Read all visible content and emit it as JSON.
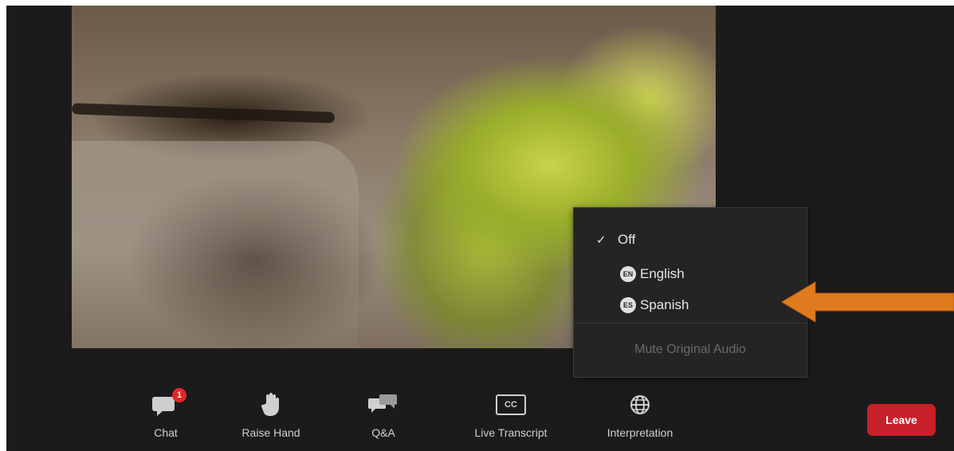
{
  "menu": {
    "items": [
      {
        "label": "Off",
        "checked": true,
        "icon": "checkmark-icon"
      },
      {
        "label": "English",
        "checked": false,
        "icon": "EN",
        "icon_name": "language-badge-icon"
      },
      {
        "label": "Spanish",
        "checked": false,
        "icon": "ES",
        "icon_name": "language-badge-icon"
      }
    ],
    "mute_label": "Mute Original Audio"
  },
  "toolbar": {
    "chat": {
      "label": "Chat",
      "badge": "1",
      "icon": "chat-icon"
    },
    "raise_hand": {
      "label": "Raise Hand",
      "icon": "hand-icon"
    },
    "qa": {
      "label": "Q&A",
      "icon": "qa-icon"
    },
    "live_transcript": {
      "label": "Live Transcript",
      "icon": "cc-icon",
      "icon_text": "CC"
    },
    "interpretation": {
      "label": "Interpretation",
      "icon": "globe-icon"
    }
  },
  "leave": {
    "label": "Leave",
    "color": "#c8202a"
  },
  "annotation": {
    "arrow_color": "#e07a1f"
  },
  "check_glyph": "✓"
}
